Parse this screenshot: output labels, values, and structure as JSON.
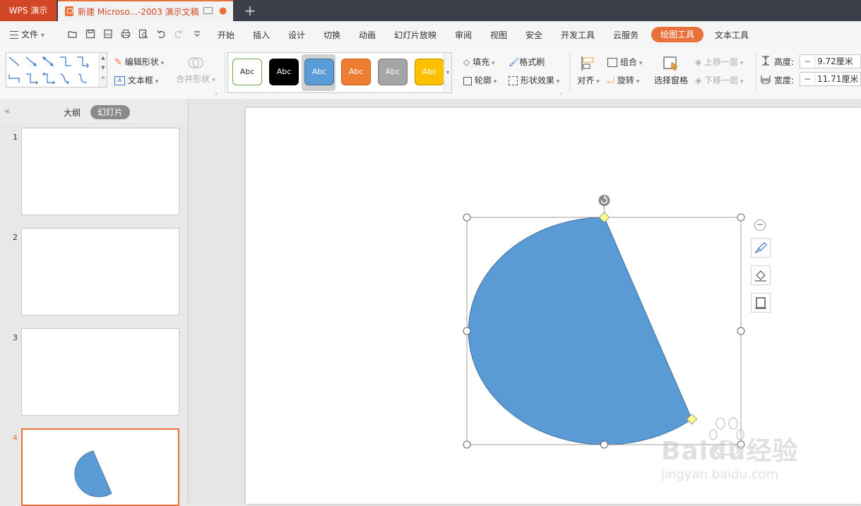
{
  "titlebar": {
    "app_tab": "WPS 演示",
    "doc_tab": "新建 Microso...-2003 演示文稿",
    "new_tab": "+"
  },
  "menubar": {
    "file": "文件",
    "tabs": [
      "开始",
      "插入",
      "设计",
      "切换",
      "动画",
      "幻灯片放映",
      "审阅",
      "视图",
      "安全",
      "开发工具",
      "云服务",
      "绘图工具",
      "文本工具"
    ],
    "active_tab": "绘图工具"
  },
  "ribbon": {
    "edit_shape": "编辑形状",
    "text_box": "文本框",
    "merge_shape": "合并形状",
    "styles": [
      {
        "label": "Abc",
        "bg": "#ffffff",
        "fg": "#333333",
        "border": "#6aa84f"
      },
      {
        "label": "Abc",
        "bg": "#000000",
        "fg": "#ffffff",
        "border": "#000000"
      },
      {
        "label": "Abc",
        "bg": "#5b9bd5",
        "fg": "#ffffff",
        "border": "#41719c"
      },
      {
        "label": "Abc",
        "bg": "#ed7d31",
        "fg": "#ffffff",
        "border": "#c55a11"
      },
      {
        "label": "Abc",
        "bg": "#a5a5a5",
        "fg": "#ffffff",
        "border": "#7b7b7b"
      },
      {
        "label": "Abc",
        "bg": "#ffc000",
        "fg": "#ffffff",
        "border": "#bf9000"
      }
    ],
    "fill": "填充",
    "outline": "轮廓",
    "format_painter": "格式刷",
    "shape_effect": "形状效果",
    "align": "对齐",
    "group": "组合",
    "rotate": "旋转",
    "selection_pane": "选择窗格",
    "bring_forward": "上移一层",
    "send_backward": "下移一层",
    "height_label": "高度:",
    "height_value": "9.72厘米",
    "width_label": "宽度:",
    "width_value": "11.71厘米"
  },
  "sidepanel": {
    "tab_outline": "大纲",
    "tab_slides": "幻灯片",
    "collapse": "«",
    "slides": [
      "1",
      "2",
      "3",
      "4"
    ],
    "active_slide": "4"
  },
  "slide": {
    "shape_fill": "#5b9bd5",
    "shape_stroke": "#41719c"
  },
  "watermark": {
    "brand": "Baidu经验",
    "url": "jingyan.baidu.com"
  }
}
